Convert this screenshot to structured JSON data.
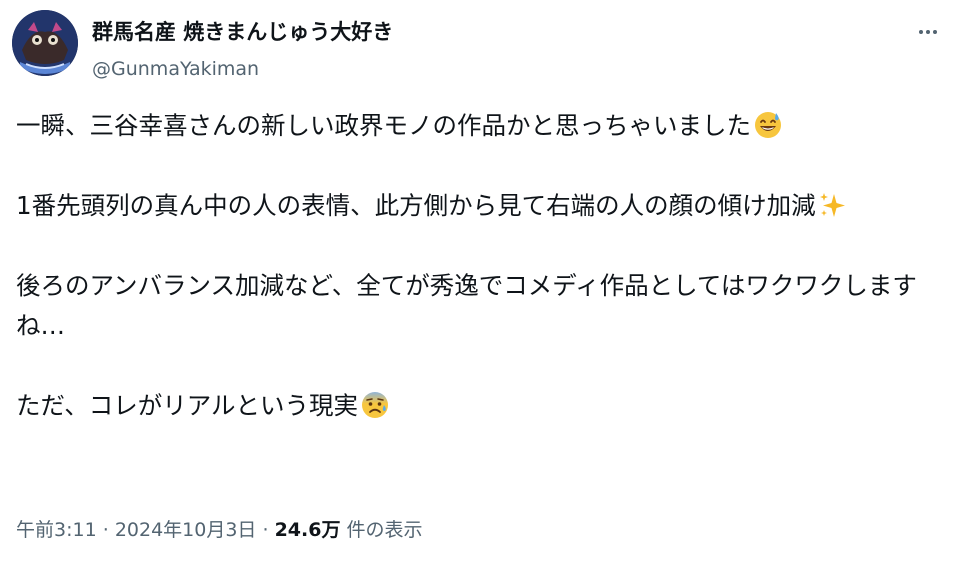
{
  "author": {
    "display_name": "群馬名産 焼きまんじゅう大好き",
    "handle": "@GunmaYakiman"
  },
  "tweet": {
    "paragraphs": [
      {
        "text": "一瞬、三谷幸喜さんの新しい政界モノの作品かと思っちゃいました",
        "emoji": "grinning-sweat-emoji"
      },
      {
        "text": "1番先頭列の真ん中の人の表情、此方側から見て右端の人の顔の傾け加減",
        "emoji": "sparkles-emoji"
      },
      {
        "text": "後ろのアンバランス加減など、全てが秀逸でコメディ作品としてはワクワクしますね…",
        "emoji": ""
      },
      {
        "text": "ただ、コレがリアルという現実",
        "emoji": "anxious-sweat-emoji"
      }
    ]
  },
  "meta": {
    "time": "午前3:11",
    "separator1": "·",
    "date": "2024年10月3日",
    "separator2": "·",
    "views_count": "24.6万",
    "views_label": "件の表示"
  },
  "icons": {
    "more": "more-horizontal-icon"
  },
  "colors": {
    "text": "#0f1419",
    "secondary": "#536471",
    "background": "#ffffff",
    "emoji_yellow": "#f7c63e",
    "sparkle": "#f6b826"
  }
}
